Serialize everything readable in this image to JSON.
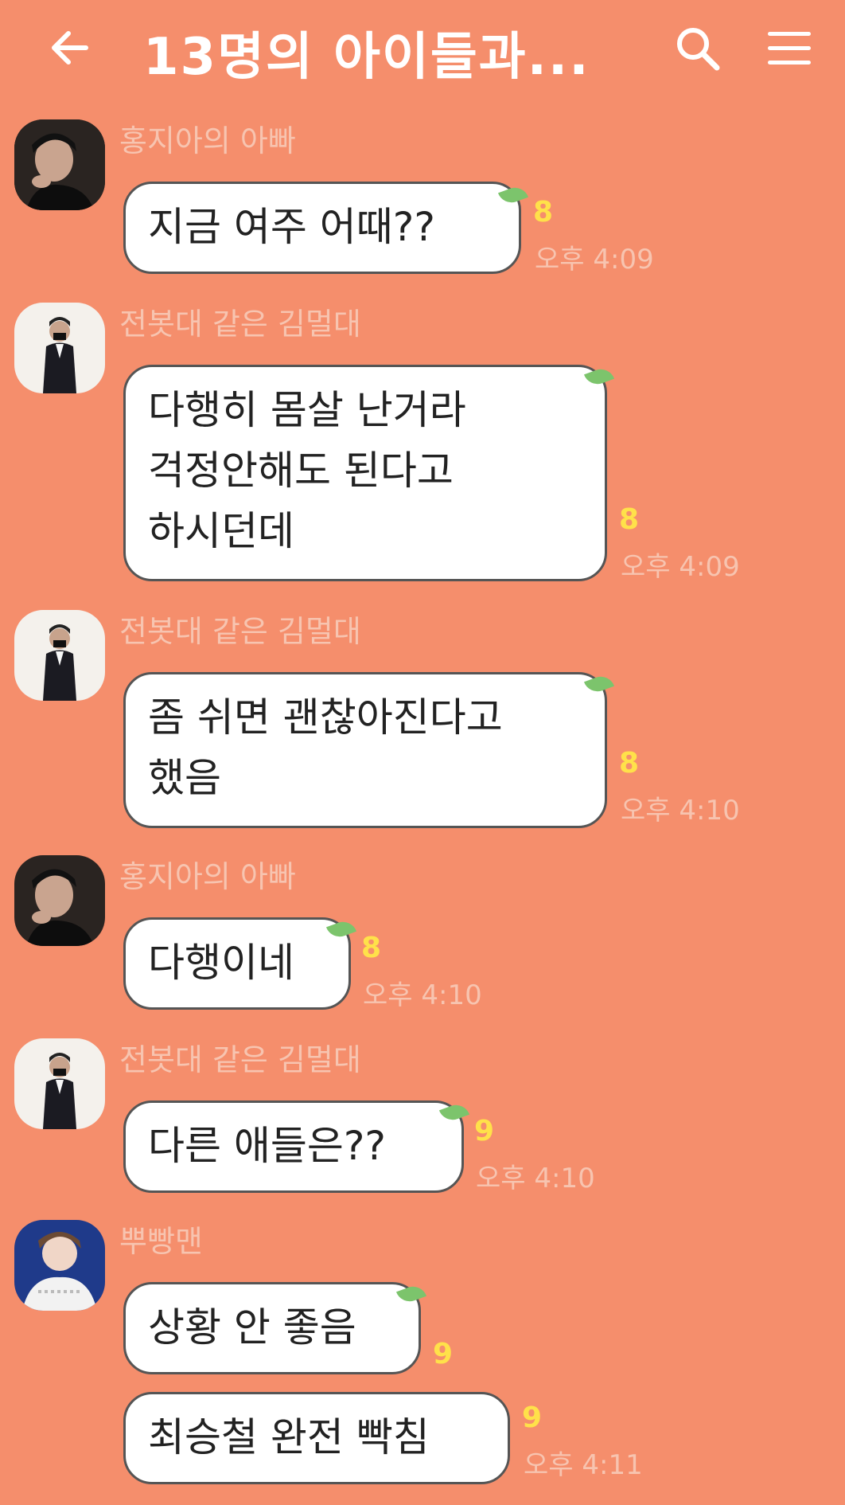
{
  "header": {
    "title": "13명의 아이들과...",
    "back_icon": "arrow-left-icon",
    "search_icon": "search-icon",
    "menu_icon": "hamburger-menu-icon"
  },
  "messages": [
    {
      "sender": "홍지아의 아빠",
      "text": "지금 여주 어때??",
      "unread": "8",
      "time": "오후 4:09"
    },
    {
      "sender": "전봇대 같은 김멀대",
      "text": "다행히 몸살 난거라\n걱정안해도 된다고\n하시던데",
      "unread": "8",
      "time": "오후 4:09"
    },
    {
      "sender": "전봇대 같은 김멀대",
      "text": "좀 쉬면 괜찮아진다고\n했음",
      "unread": "8",
      "time": "오후 4:10"
    },
    {
      "sender": "홍지아의 아빠",
      "text": "다행이네",
      "unread": "8",
      "time": "오후 4:10"
    },
    {
      "sender": "전봇대 같은 김멀대",
      "text": "다른 애들은??",
      "unread": "9",
      "time": "오후 4:10"
    },
    {
      "sender": "뿌빵맨",
      "text": "상황 안 좋음",
      "unread": "9",
      "time": ""
    },
    {
      "sender": "",
      "text": "최승철 완전 빡침",
      "unread": "9",
      "time": "오후 4:11"
    }
  ]
}
